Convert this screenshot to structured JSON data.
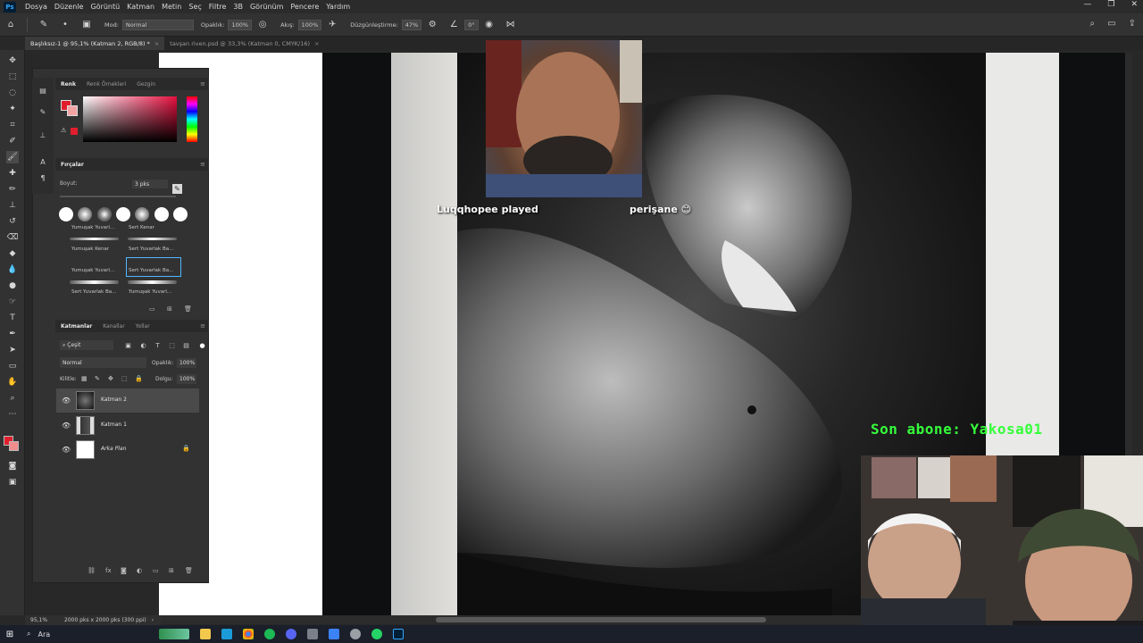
{
  "menu": [
    "Dosya",
    "Düzenle",
    "Görüntü",
    "Katman",
    "Metin",
    "Seç",
    "Filtre",
    "3B",
    "Görünüm",
    "Pencere",
    "Yardım"
  ],
  "app_badge": "Ps",
  "options": {
    "mode_label": "Mod:",
    "mode_value": "Normal",
    "opacity_label": "Opaklık:",
    "opacity_value": "100%",
    "flow_label": "Akış:",
    "flow_value": "100%",
    "smoothing_label": "Düzgünleştirme:",
    "smoothing_value": "47%",
    "angle_value": "0°"
  },
  "doc_tabs": [
    {
      "label": "Başlıksız-1 @ 95,1% (Katman 2, RGB/8) *",
      "active": true
    },
    {
      "label": "tavşan riven.psd @ 33,3% (Katman 0, CMYK/16)",
      "active": false
    }
  ],
  "color_panel": {
    "tabs": [
      "Renk",
      "Renk Örnekleri",
      "Gezgin"
    ],
    "fg_color": "#e11f2c",
    "bg_color": "#f2a3a3"
  },
  "brushes_panel": {
    "title": "Fırçalar",
    "size_label": "Boyut:",
    "size_value": "3 pks",
    "presets": [
      "Yumuşak Yuvarl...",
      "Sert Kenar",
      "Yumuşak Kenar",
      "Sert Yuvarlak Ba...",
      "Yumuşak Yuvarl...",
      "Sert Yuvarlak Ba...",
      "Sert Yuvarlak Ba...",
      "Yumuşak Yuvarl..."
    ]
  },
  "layers_panel": {
    "tabs": [
      "Katmanlar",
      "Kanallar",
      "Yollar"
    ],
    "filter_label": "Çeşit",
    "blend_mode": "Normal",
    "opacity_label": "Opaklık:",
    "opacity_value": "100%",
    "lock_label": "Kilitle:",
    "fill_label": "Dolgu:",
    "fill_value": "100%",
    "layers": [
      {
        "name": "Katman 2",
        "selected": true,
        "locked": false
      },
      {
        "name": "Katman 1",
        "selected": false,
        "locked": false
      },
      {
        "name": "Arka Plan",
        "selected": false,
        "locked": true
      }
    ]
  },
  "overlay": {
    "alert_left": "Luqqhopee played",
    "alert_right": "perişane 😊",
    "last_sub": "Son abone: Yakosa01"
  },
  "status": {
    "zoom": "95,1%",
    "doc_info": "2000 pks x 2000 pks (300 ppi)"
  },
  "taskbar": {
    "search_placeholder": "Ara"
  }
}
